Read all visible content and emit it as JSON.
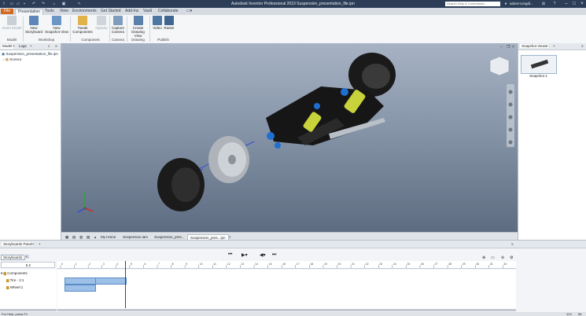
{
  "window": {
    "title": "Autodesk Inventor Professional 2019   Suspension_presentation_file.ipn",
    "search_placeholder": "Search Help & Commands...",
    "user": "adamrcongdi..."
  },
  "ribbon_tabs": [
    "File",
    "Presentation",
    "Tools",
    "View",
    "Environments",
    "Get Started",
    "Add-Ins",
    "Vault",
    "Collaborate"
  ],
  "ribbon": {
    "buttons": {
      "insert_model": "Insert Model",
      "new_storyboard_1": "New",
      "new_storyboard_2": "Storyboard",
      "new_snapshot_1": "New",
      "new_snapshot_2": "Snapshot View",
      "tweak_1": "Tweak",
      "tweak_2": "Components",
      "opacity": "Opacity",
      "capture_1": "Capture",
      "capture_2": "Camera",
      "drawing_1": "Create",
      "drawing_2": "Drawing View",
      "video": "Video",
      "raster": "Raster"
    },
    "groups": [
      "Model",
      "Workshop",
      "Component",
      "Camera",
      "Drawing",
      "Publish"
    ]
  },
  "browser": {
    "tabs": [
      "Model",
      "Logs"
    ],
    "items": [
      "Suspension_presentation_file.ipn",
      "Scene1"
    ]
  },
  "snapshot_panel": {
    "title": "Snapshot Views",
    "item_label": "Snapshot 1"
  },
  "doc_tabs": [
    "My Home",
    "Suspension.iam",
    "Suspension_pres...",
    "Suspension_pres...ipn"
  ],
  "storyboard": {
    "panel_title": "Storyboards Panel",
    "tab": "Storyboard1",
    "time_value": "5.2",
    "tracks_root": "Components",
    "tracks": [
      "Tire - 2:1",
      "Wheel:1"
    ],
    "ruler_ticks": [
      "0",
      "1",
      "2",
      "3",
      "4",
      "5",
      "6",
      "7",
      "8",
      "9",
      "10",
      "11",
      "12",
      "13",
      "14",
      "15",
      "16",
      "17",
      "18",
      "19",
      "20",
      "21",
      "22",
      "23",
      "24",
      "25",
      "26",
      "27",
      "28",
      "29",
      "30",
      "31",
      "32"
    ]
  },
  "status": {
    "help": "For Help, press F1",
    "count1": "124",
    "count2": "56"
  },
  "colors": {
    "title_bar": "#2c3e57",
    "file_tab": "#d2691e",
    "accent_blue": "#1f6fd1",
    "spring_yellow": "#c8d23a"
  }
}
